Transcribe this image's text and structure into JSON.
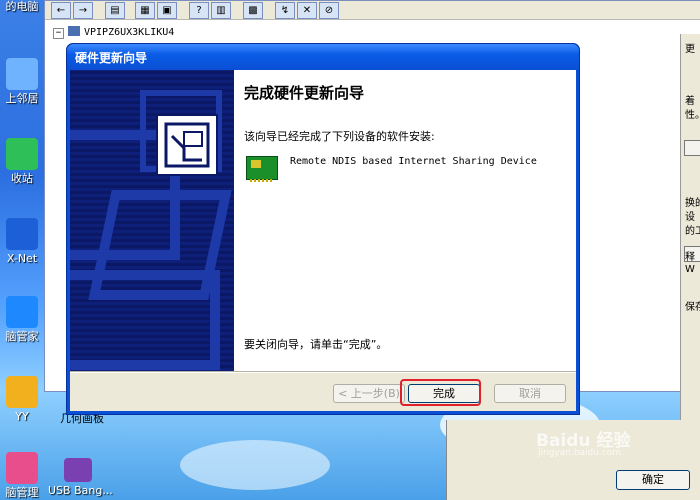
{
  "desktop": {
    "icons": [
      {
        "label": "的电脑"
      },
      {
        "label": "上邻居"
      },
      {
        "label": "收站"
      },
      {
        "label": "X-Net"
      },
      {
        "label": "脑管家"
      },
      {
        "label": "YY"
      },
      {
        "label": "脑管理"
      },
      {
        "label": "USB Bang..."
      }
    ],
    "partial_text": "几何画板"
  },
  "background_window": {
    "tree_root_label": "VPIPZ6UX3KLIKU4",
    "ok_button_label": "确定"
  },
  "right_strip": {
    "lines": [
      "更",
      "着",
      "性。",
      "换的",
      "设",
      "的工",
      "释",
      "W",
      "保存"
    ]
  },
  "wizard": {
    "title": "硬件更新向导",
    "heading": "完成硬件更新向导",
    "intro": "该向导已经完成了下列设备的软件安装:",
    "device_name": "Remote NDIS based Internet Sharing Device",
    "closing_text": "要关闭向导，请单击“完成”。",
    "buttons": {
      "back": "< 上一步(B)",
      "finish": "完成",
      "cancel": "取消"
    },
    "highlight_color": "#e0202a"
  },
  "watermark": {
    "logo": "Baidu 经验",
    "url": "jingyan.baidu.com"
  },
  "colors": {
    "titlebar": "#0a4fd4",
    "dialog_face": "#ece9d8",
    "left_panel": "#0e1f7a"
  }
}
